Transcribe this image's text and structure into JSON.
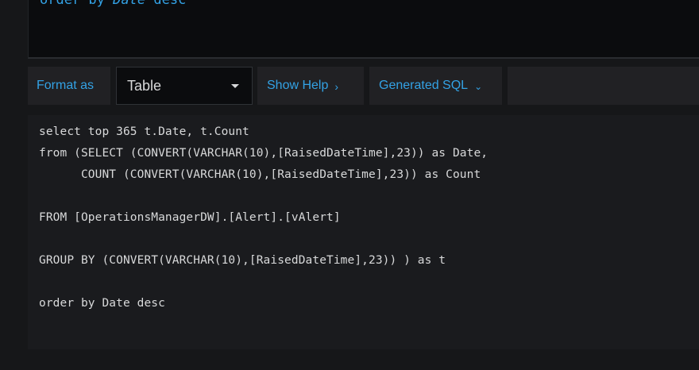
{
  "editor": {
    "visible_line_keyword": "order by",
    "visible_line_field": "Date",
    "visible_line_tail": "desc"
  },
  "toolbar": {
    "format_as_label": "Format as",
    "format_select_value": "Table",
    "show_help_label": "Show Help",
    "generated_sql_label": "Generated SQL"
  },
  "generated_sql": {
    "lines": [
      "select top 365 t.Date, t.Count",
      "from (SELECT (CONVERT(VARCHAR(10),[RaisedDateTime],23)) as Date,",
      "      COUNT (CONVERT(VARCHAR(10),[RaisedDateTime],23)) as Count",
      "",
      "FROM [OperationsManagerDW].[Alert].[vAlert]",
      "",
      "GROUP BY (CONVERT(VARCHAR(10),[RaisedDateTime],23)) ) as t",
      "",
      "order by Date desc"
    ]
  },
  "colors": {
    "accent": "#33a2e5",
    "background": "#161719",
    "panel": "#212124",
    "editor_bg": "#0b0c0e",
    "text": "#d8d9da"
  },
  "icons": {
    "format_select_caret": "caret-down-icon",
    "show_help_chevron": "chevron-right-icon",
    "generated_sql_chevron": "chevron-down-icon"
  }
}
